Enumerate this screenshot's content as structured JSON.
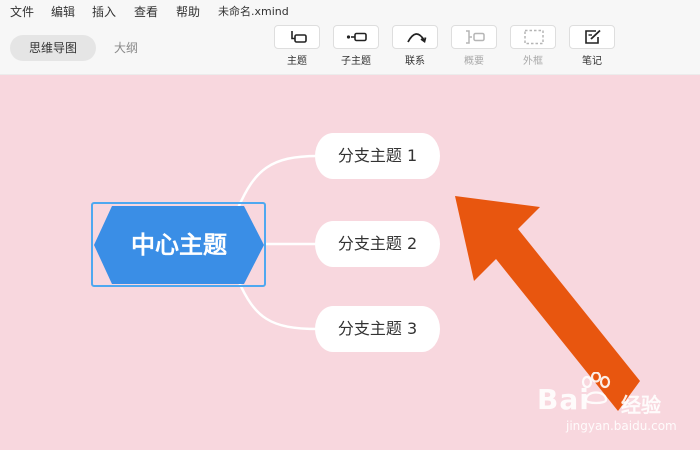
{
  "menubar": {
    "items": [
      "文件",
      "编辑",
      "插入",
      "查看",
      "帮助"
    ],
    "filename": "未命名.xmind"
  },
  "view_tabs": [
    {
      "label": "思维导图",
      "active": true
    },
    {
      "label": "大纲",
      "active": false
    }
  ],
  "toolbar": [
    {
      "label": "主题",
      "icon": "topic-icon",
      "enabled": true
    },
    {
      "label": "子主题",
      "icon": "subtopic-icon",
      "enabled": true
    },
    {
      "label": "联系",
      "icon": "relationship-icon",
      "enabled": true
    },
    {
      "label": "概要",
      "icon": "summary-icon",
      "enabled": false
    },
    {
      "label": "外框",
      "icon": "boundary-icon",
      "enabled": false
    },
    {
      "label": "笔记",
      "icon": "note-icon",
      "enabled": true
    }
  ],
  "mindmap": {
    "central_topic": "中心主题",
    "branches": [
      "分支主题 1",
      "分支主题 2",
      "分支主题 3"
    ]
  },
  "colors": {
    "canvas_bg": "#f8d7de",
    "central_fill": "#3a8ee6",
    "selection_border": "#4ea8f0",
    "arrow": "#e8560f"
  },
  "watermark": {
    "brand": "Bai",
    "brand_suffix": "经验",
    "url": "jingyan.baidu.com"
  }
}
